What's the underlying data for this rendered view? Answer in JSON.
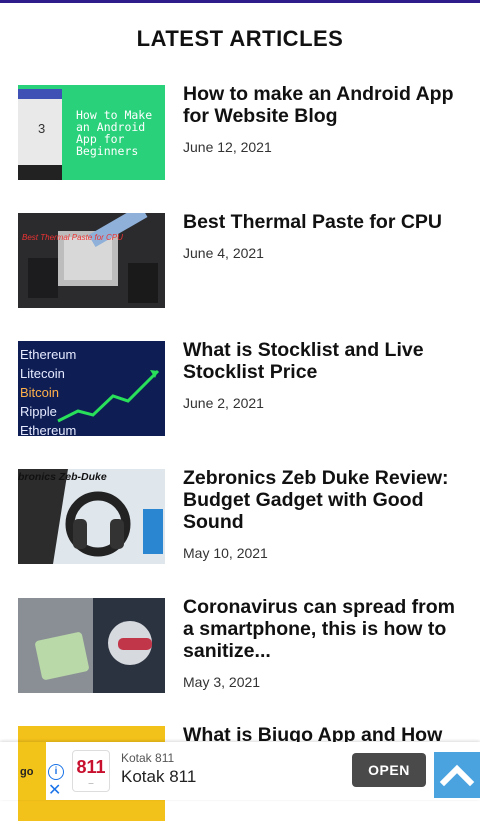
{
  "section": {
    "title": "LATEST ARTICLES"
  },
  "articles": [
    {
      "title": "How to make an Android App for Website Blog",
      "date": "June 12, 2021",
      "thumb_text": "How to Make an Android App for Beginners"
    },
    {
      "title": "Best Thermal Paste for CPU",
      "date": "June 4, 2021",
      "thumb_text": "Best Thermal Paste for CPU"
    },
    {
      "title": "What is Stocklist and Live Stocklist Price",
      "date": "June 2, 2021",
      "thumb_coins": [
        "Ethereum",
        "Litecoin",
        "Bitcoin",
        "Ripple",
        "Ethereum"
      ]
    },
    {
      "title": "Zebronics Zeb Duke Review: Budget Gadget with Good Sound",
      "date": "May 10, 2021",
      "thumb_text": "bronics Zeb-Duke"
    },
    {
      "title": "Coronavirus can spread from a smartphone, this is how to sanitize...",
      "date": "May 3, 2021"
    },
    {
      "title": "What is Biugo App and How"
    }
  ],
  "ad": {
    "advertiser_small": "Kotak 811",
    "advertiser_big": "Kotak 811",
    "logo_text": "811",
    "cta": "OPEN",
    "strip_text": "go"
  },
  "icons": [
    "info-icon",
    "close-icon",
    "arrow-up-icon"
  ]
}
